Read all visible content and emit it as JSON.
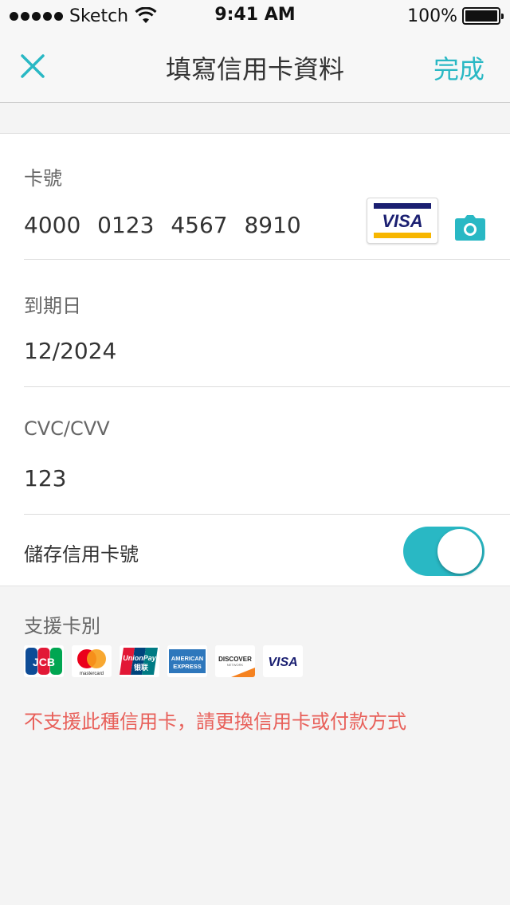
{
  "status_bar": {
    "carrier": "Sketch",
    "time": "9:41 AM",
    "battery": "100%"
  },
  "nav": {
    "title": "填寫信用卡資料",
    "done_label": "完成",
    "close_icon": "close-icon"
  },
  "form": {
    "card_number": {
      "label": "卡號",
      "value": "4000 0123 4567 8910",
      "brand_badge": "VISA"
    },
    "expiry": {
      "label": "到期日",
      "value": "12/2024"
    },
    "cvc": {
      "label": "CVC/CVV",
      "value": "123"
    },
    "save_card": {
      "label": "儲存信用卡號",
      "enabled": true
    }
  },
  "supported": {
    "label": "支援卡別",
    "brands": [
      {
        "name": "JCB",
        "text": "JCB"
      },
      {
        "name": "mastercard",
        "text": "mastercard"
      },
      {
        "name": "unionpay",
        "text": "UnionPay",
        "text2": "银联"
      },
      {
        "name": "american-express",
        "text": "AMERICAN",
        "text2": "EXPRESS"
      },
      {
        "name": "discover",
        "text": "DISCOVER",
        "text2": "NETWORK"
      },
      {
        "name": "visa",
        "text": "VISA"
      }
    ]
  },
  "error_message": "不支援此種信用卡，請更換信用卡或付款方式",
  "colors": {
    "accent": "#29b8c4",
    "error": "#e8605a",
    "visa_blue": "#1a1f71",
    "visa_gold": "#f7b600"
  }
}
